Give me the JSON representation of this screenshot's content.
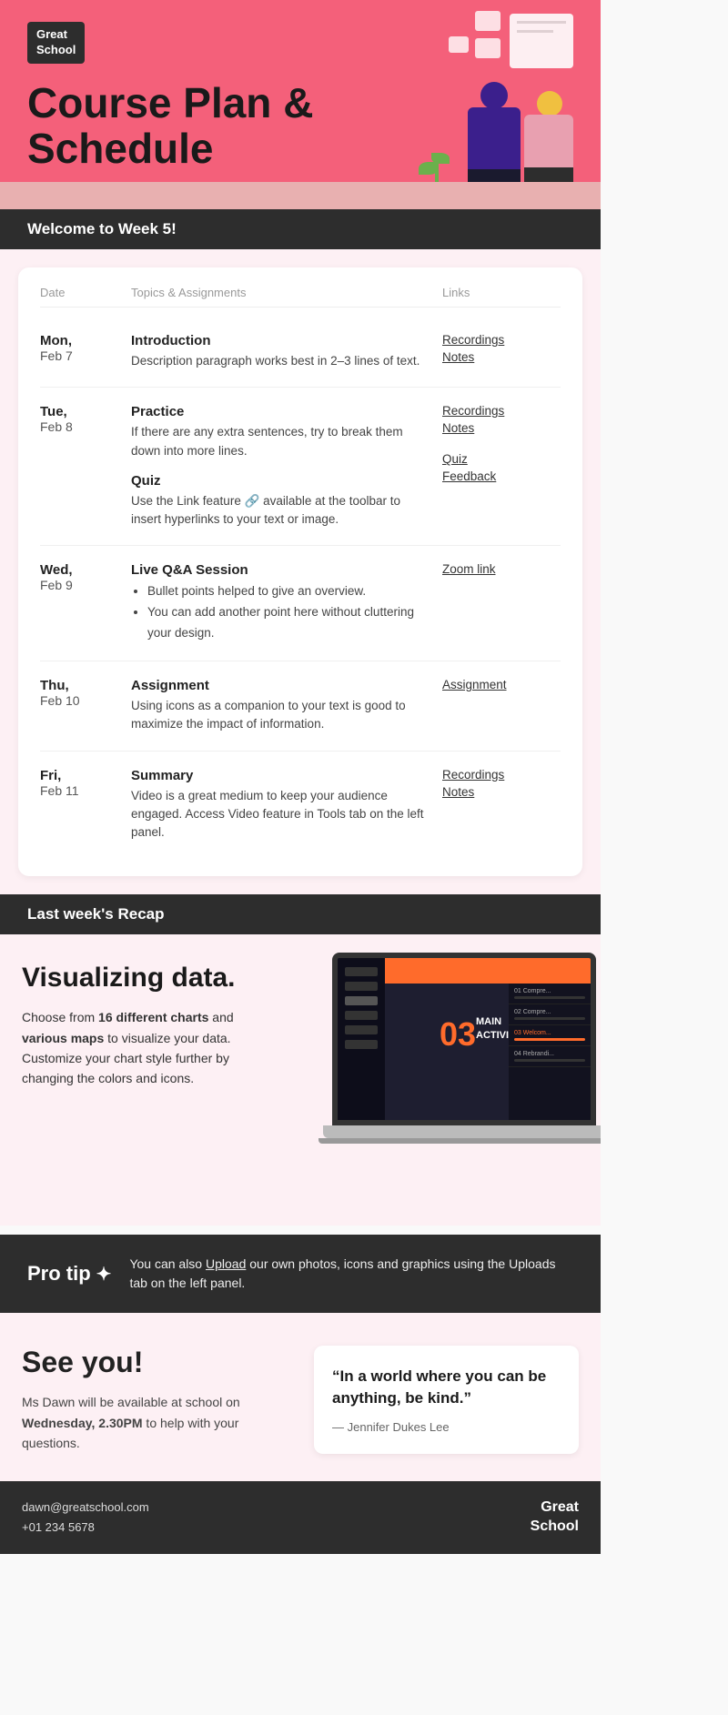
{
  "header": {
    "logo": "Great\nSchool",
    "title_line1": "Course Plan &",
    "title_line2": "Schedule"
  },
  "week_banner": {
    "prefix": "Welcome to ",
    "week": "Week 5!"
  },
  "schedule": {
    "columns": {
      "date": "Date",
      "topics": "Topics & Assignments",
      "links": "Links"
    },
    "rows": [
      {
        "day": "Mon,",
        "date": "Feb 7",
        "topics": [
          {
            "title": "Introduction",
            "desc": "Description paragraph works best in 2–3 lines of text.",
            "bullets": []
          }
        ],
        "links": [
          "Recordings",
          "Notes"
        ]
      },
      {
        "day": "Tue,",
        "date": "Feb 8",
        "topics": [
          {
            "title": "Practice",
            "desc": "If there are any extra sentences, try to break them down into more lines.",
            "bullets": []
          },
          {
            "title": "Quiz",
            "desc": "Use the Link feature 🔗 available at the toolbar to insert hyperlinks to your text or image.",
            "bullets": []
          }
        ],
        "links": [
          "Recordings",
          "Notes",
          "Quiz",
          "Feedback"
        ]
      },
      {
        "day": "Wed,",
        "date": "Feb 9",
        "topics": [
          {
            "title": "Live Q&A Session",
            "desc": "",
            "bullets": [
              "Bullet points helped to give an overview.",
              "You can add another point here without cluttering your design."
            ]
          }
        ],
        "links": [
          "Zoom link"
        ]
      },
      {
        "day": "Thu,",
        "date": "Feb 10",
        "topics": [
          {
            "title": "Assignment",
            "desc": "Using icons as a companion to your text is good to maximize the impact of information.",
            "bullets": []
          }
        ],
        "links": [
          "Assignment"
        ]
      },
      {
        "day": "Fri,",
        "date": "Feb 11",
        "topics": [
          {
            "title": "Summary",
            "desc": "Video is a great medium to keep your audience engaged. Access Video feature in Tools tab on the left panel.",
            "bullets": []
          }
        ],
        "links": [
          "Recordings",
          "Notes"
        ]
      }
    ]
  },
  "recap_banner": {
    "prefix": "Last week's ",
    "word": "Recap"
  },
  "recap": {
    "title": "Visualizing data.",
    "desc_parts": [
      "Choose from ",
      "16 different charts",
      " and ",
      "various maps",
      " to visualize your data. Customize your chart style further by changing the colors and icons."
    ]
  },
  "laptop_screen": {
    "number": "03",
    "main_text": "MAIN\nACTIVITIES",
    "list_items": [
      "01  Compre...",
      "02  Compre...",
      "03  Welcom...",
      "04  Rebrandi..."
    ]
  },
  "pro_tip": {
    "label": "Pro tip",
    "star": "✦",
    "text_parts": [
      "You can also ",
      "Upload",
      " our own photos, icons and graphics using the Uploads tab on the left panel."
    ]
  },
  "footer": {
    "see_you_title": "See you!",
    "see_you_desc_parts": [
      "Ms Dawn will be available at school on ",
      "Wednesday, 2.30PM",
      " to help with your questions."
    ],
    "quote_text": "“In a world where you can be anything, be kind.”",
    "quote_author": "— Jennifer Dukes Lee"
  },
  "bottom_bar": {
    "email": "dawn@greatschool.com",
    "phone": "+01 234 5678",
    "logo": "Great\nSchool"
  }
}
